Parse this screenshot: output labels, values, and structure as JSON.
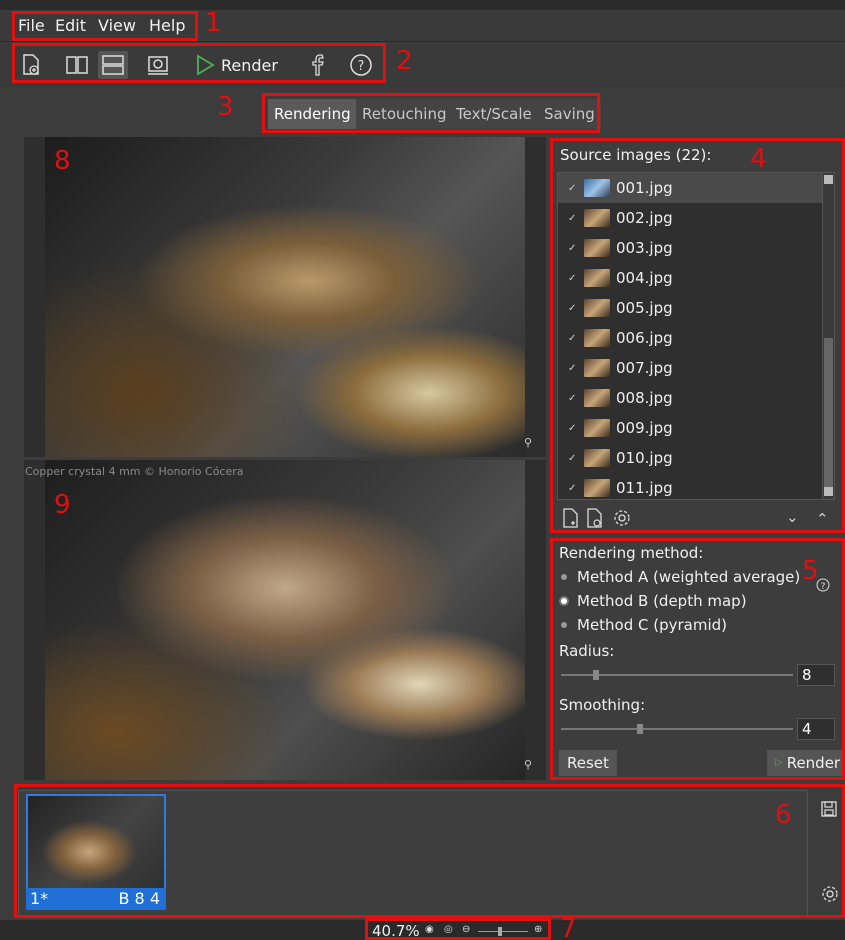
{
  "menu": [
    "File",
    "Edit",
    "View",
    "Help"
  ],
  "toolbar": {
    "render_label": "Render",
    "help_glyph": "?"
  },
  "tabs": [
    "Rendering",
    "Retouching",
    "Text/Scale",
    "Saving"
  ],
  "watermark": "Copper crystal 4 mm © Honorio Cócera",
  "annotations": [
    "1",
    "2",
    "3",
    "4",
    "5",
    "6",
    "7",
    "8",
    "9"
  ],
  "sources": {
    "title": "Source images (22):",
    "items": [
      "001.jpg",
      "002.jpg",
      "003.jpg",
      "004.jpg",
      "005.jpg",
      "006.jpg",
      "007.jpg",
      "008.jpg",
      "009.jpg",
      "010.jpg",
      "011.jpg"
    ],
    "check_glyph": "✓"
  },
  "rendering": {
    "title": "Rendering method:",
    "methods": [
      "Method A (weighted average)",
      "Method B (depth map)",
      "Method C (pyramid)"
    ],
    "selected": 1,
    "radius_label": "Radius:",
    "radius_value": "8",
    "smoothing_label": "Smoothing:",
    "smoothing_value": "4",
    "reset_label": "Reset",
    "render_label": "Render"
  },
  "filmstrip": {
    "thumb_left": "1*",
    "thumb_right": "B 8 4"
  },
  "status": {
    "zoom": "40.7%"
  },
  "colors": {
    "accent_red": "#e01010",
    "selection_blue": "#1f6fd6",
    "play_green": "#4caf50"
  }
}
